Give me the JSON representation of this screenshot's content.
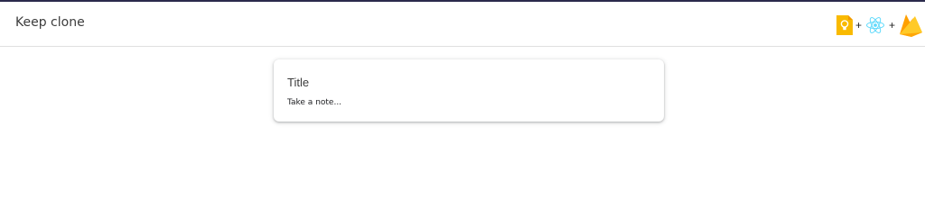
{
  "header": {
    "app_title": "Keep clone",
    "plus_sign_1": "+",
    "plus_sign_2": "+",
    "logos": [
      "google-keep-icon",
      "react-icon",
      "firebase-icon"
    ]
  },
  "note_input": {
    "title_placeholder": "Title",
    "body_placeholder": "Take a note..."
  },
  "colors": {
    "topline": "#2b2a4c",
    "keep_yellow": "#f9ba00",
    "react_blue": "#61dafb",
    "firebase_orange": "#ffa000",
    "firebase_yellow": "#ffca28"
  }
}
